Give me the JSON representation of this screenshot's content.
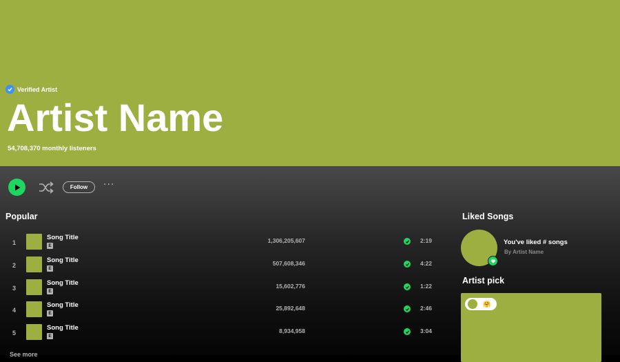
{
  "header": {
    "verified_label": "Verified Artist",
    "artist_name": "Artist Name",
    "monthly_listeners": "54,708,370 monthly listeners",
    "hero_color": "#9eaf42"
  },
  "actions": {
    "play_icon": "play-icon",
    "shuffle_icon": "shuffle-icon",
    "follow_label": "Follow",
    "more_label": "···"
  },
  "popular": {
    "title": "Popular",
    "explicit_label": "E",
    "tracks": [
      {
        "number": "1",
        "title": "Song Title",
        "plays": "1,306,205,607",
        "duration": "2:19"
      },
      {
        "number": "2",
        "title": "Song Title",
        "plays": "507,608,346",
        "duration": "4:22"
      },
      {
        "number": "3",
        "title": "Song Title",
        "plays": "15,602,776",
        "duration": "1:22"
      },
      {
        "number": "4",
        "title": "Song Title",
        "plays": "25,892,648",
        "duration": "2:46"
      },
      {
        "number": "5",
        "title": "Song Title",
        "plays": "8,934,958",
        "duration": "3:04"
      }
    ],
    "see_more_label": "See more"
  },
  "liked_songs": {
    "title": "Liked Songs",
    "line1": "You've liked # songs",
    "line2": "By Artist Name"
  },
  "artist_pick": {
    "title": "Artist pick",
    "emoji": "🤗"
  },
  "colors": {
    "accent": "#1ed760",
    "verified": "#3d91f4"
  }
}
